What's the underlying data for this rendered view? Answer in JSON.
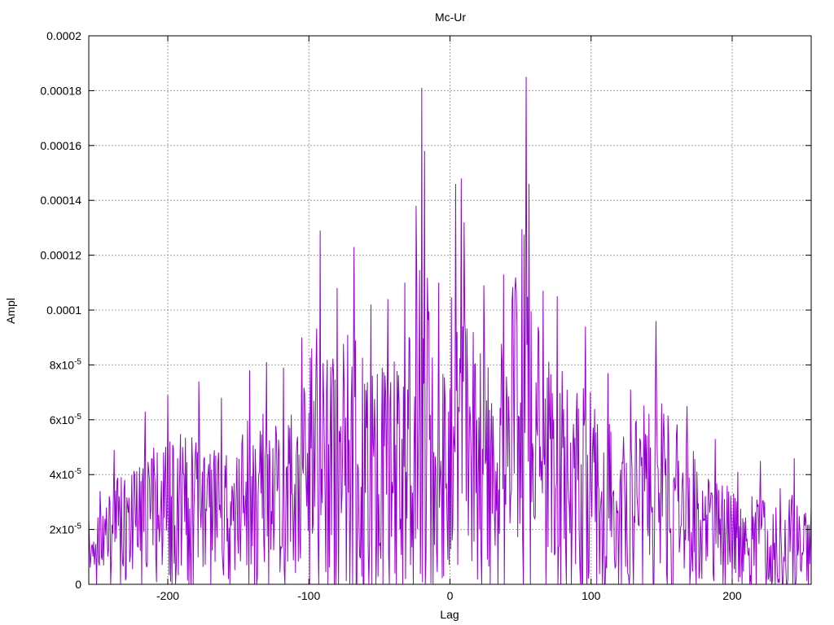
{
  "chart_data": {
    "type": "line",
    "title": "Mc-Ur",
    "xlabel": "Lag",
    "ylabel": "Ampl",
    "xlim": [
      -256,
      256
    ],
    "ylim": [
      0,
      0.0002
    ],
    "grid": true,
    "legend": "none",
    "series_color": "#9400d3",
    "x_ticks": [
      -200,
      -100,
      0,
      100,
      200
    ],
    "x_tick_labels": [
      "-200",
      "-100",
      "0",
      "100",
      "200"
    ],
    "y_ticks": [
      0,
      2e-05,
      4e-05,
      6e-05,
      8e-05,
      0.0001,
      0.00012,
      0.00014,
      0.00016,
      0.00018,
      0.0002
    ],
    "y_tick_labels": [
      {
        "base": "0",
        "exp": ""
      },
      {
        "base": "2x10",
        "exp": "-5"
      },
      {
        "base": "4x10",
        "exp": "-5"
      },
      {
        "base": "6x10",
        "exp": "-5"
      },
      {
        "base": "8x10",
        "exp": "-5"
      },
      {
        "base": "0.0001",
        "exp": ""
      },
      {
        "base": "0.00012",
        "exp": ""
      },
      {
        "base": "0.00014",
        "exp": ""
      },
      {
        "base": "0.00016",
        "exp": ""
      },
      {
        "base": "0.00018",
        "exp": ""
      },
      {
        "base": "0.0002",
        "exp": ""
      }
    ],
    "peaks": [
      {
        "x": -256,
        "y": 2.4e-05
      },
      {
        "x": -248,
        "y": 3.4e-05
      },
      {
        "x": -238,
        "y": 4.9e-05
      },
      {
        "x": -216,
        "y": 6.3e-05
      },
      {
        "x": -200,
        "y": 6.9e-05
      },
      {
        "x": -178,
        "y": 7.4e-05
      },
      {
        "x": -162,
        "y": 6.8e-05
      },
      {
        "x": -142,
        "y": 7.8e-05
      },
      {
        "x": -130,
        "y": 8.1e-05
      },
      {
        "x": -118,
        "y": 7.9e-05
      },
      {
        "x": -105,
        "y": 9e-05
      },
      {
        "x": -92,
        "y": 0.000129
      },
      {
        "x": -80,
        "y": 0.000108
      },
      {
        "x": -68,
        "y": 0.000123
      },
      {
        "x": -56,
        "y": 0.000102
      },
      {
        "x": -44,
        "y": 0.000104
      },
      {
        "x": -32,
        "y": 0.00011
      },
      {
        "x": -24,
        "y": 0.000138
      },
      {
        "x": -20,
        "y": 0.000181
      },
      {
        "x": -18,
        "y": 0.000158
      },
      {
        "x": -8,
        "y": 0.00011
      },
      {
        "x": 4,
        "y": 0.000146
      },
      {
        "x": 8,
        "y": 0.000148
      },
      {
        "x": 10,
        "y": 0.000132
      },
      {
        "x": 24,
        "y": 0.000109
      },
      {
        "x": 38,
        "y": 0.000113
      },
      {
        "x": 54,
        "y": 0.000185
      },
      {
        "x": 56,
        "y": 0.000146
      },
      {
        "x": 66,
        "y": 0.000107
      },
      {
        "x": 76,
        "y": 0.000105
      },
      {
        "x": 96,
        "y": 9.4e-05
      },
      {
        "x": 112,
        "y": 7.7e-05
      },
      {
        "x": 128,
        "y": 7.1e-05
      },
      {
        "x": 146,
        "y": 9.6e-05
      },
      {
        "x": 168,
        "y": 6.5e-05
      },
      {
        "x": 188,
        "y": 5.3e-05
      },
      {
        "x": 204,
        "y": 4.1e-05
      },
      {
        "x": 220,
        "y": 4.5e-05
      },
      {
        "x": 234,
        "y": 3.5e-05
      },
      {
        "x": 244,
        "y": 4.6e-05
      },
      {
        "x": 256,
        "y": 2.8e-05
      }
    ],
    "seed": 1337
  }
}
